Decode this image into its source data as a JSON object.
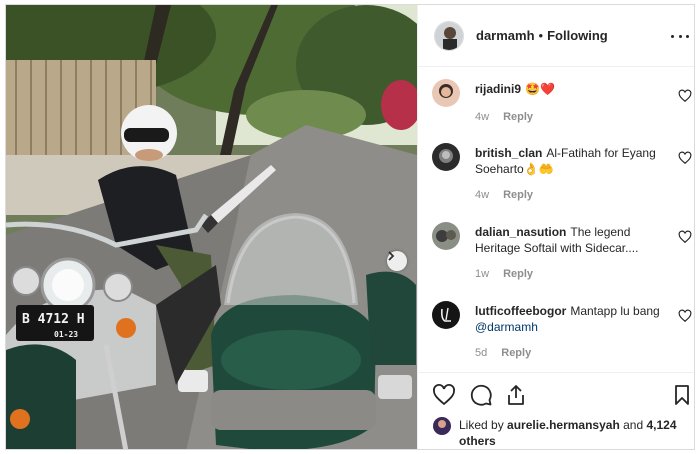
{
  "post": {
    "author": {
      "username": "darmamh",
      "separator": "•",
      "follow_status": "Following"
    },
    "photo": {
      "plate_number": "B 4712 H",
      "plate_code": "01-23"
    },
    "comments": [
      {
        "username": "rijadini9",
        "text": "🤩❤️",
        "mention": "",
        "age": "4w",
        "reply_label": "Reply"
      },
      {
        "username": "british_clan",
        "text": "Al-Fatihah for Eyang Soeharto👌🤲",
        "mention": "",
        "age": "4w",
        "reply_label": "Reply"
      },
      {
        "username": "dalian_nasution",
        "text": "The legend Heritage Softail with Sidecar....",
        "mention": "",
        "age": "1w",
        "reply_label": "Reply"
      },
      {
        "username": "lutficoffeebogor",
        "text": "Mantapp lu bang",
        "mention": "@darmamh",
        "age": "5d",
        "reply_label": "Reply"
      }
    ],
    "likes": {
      "prefix": "Liked by",
      "user": "aurelie.hermansyah",
      "conjunction": "and",
      "others": "4,124 others"
    },
    "icons": {
      "like": "heart-icon",
      "comment": "comment-icon",
      "share": "share-icon",
      "save": "bookmark-icon",
      "more": "more-options-icon",
      "next": "chevron-right-icon"
    }
  }
}
